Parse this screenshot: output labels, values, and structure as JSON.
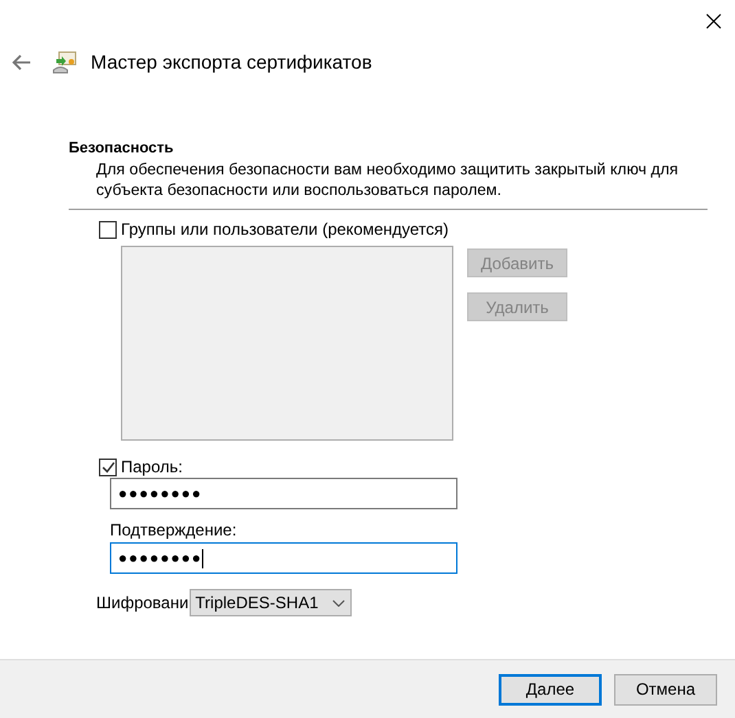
{
  "window": {
    "title": "Мастер экспорта сертификатов"
  },
  "section": {
    "title": "Безопасность",
    "description": "Для обеспечения безопасности вам необходимо защитить закрытый ключ для субъекта безопасности или воспользоваться паролем."
  },
  "principals": {
    "label": "Группы или пользователи (рекомендуется)",
    "checked": false,
    "buttons": [
      {
        "label": "Добавить",
        "disabled": true
      },
      {
        "label": "Удалить",
        "disabled": true
      }
    ]
  },
  "password": {
    "label": "Пароль:",
    "checked": true,
    "value": "●●●●●●●●",
    "focused": false
  },
  "confirmation": {
    "label": "Подтверждение:",
    "value": "●●●●●●●●",
    "focused": true
  },
  "encryption": {
    "label": "Шифровани",
    "value": "TripleDES-SHA1"
  },
  "buttons": [
    {
      "label": "Далее",
      "default": true
    },
    {
      "label": "Отмена",
      "default": false
    }
  ]
}
